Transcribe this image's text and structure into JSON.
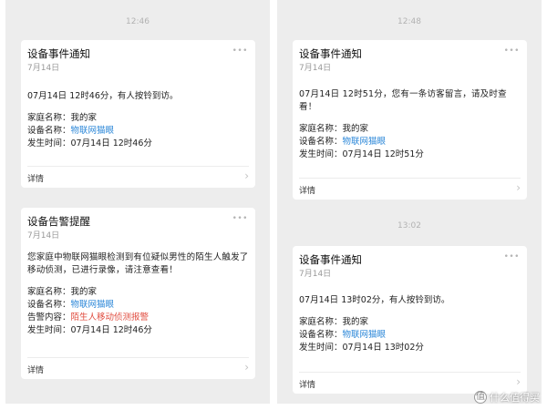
{
  "left_panel": {
    "timestamp": "12:46",
    "card1": {
      "title": "设备事件通知",
      "date": "7月14日",
      "message": "07月14日 12时46分，有人按铃到访。",
      "home_label": "家庭名称：",
      "home_value": "我的家",
      "device_label": "设备名称：",
      "device_value": "物联网猫眼",
      "time_label": "发生时间：",
      "time_value": "07月14日 12时46分",
      "detail": "详情"
    },
    "card2": {
      "title": "设备告警提醒",
      "date": "7月14日",
      "message": "您家庭中物联网猫眼检测到有位疑似男性的陌生人触发了移动侦测，已进行录像，请注意查看！",
      "home_label": "家庭名称：",
      "home_value": "我的家",
      "device_label": "设备名称：",
      "device_value": "物联网猫眼",
      "alert_label": "告警内容：",
      "alert_value": "陌生人移动侦测报警",
      "time_label": "发生时间：",
      "time_value": "07月14日 12时46分",
      "detail": "详情"
    }
  },
  "right_panel": {
    "timestamp1": "12:48",
    "card1": {
      "title": "设备事件通知",
      "date": "7月14日",
      "message": "07月14日 12时51分，您有一条访客留言，请及时查看！",
      "home_label": "家庭名称：",
      "home_value": "我的家",
      "device_label": "设备名称：",
      "device_value": "物联网猫眼",
      "time_label": "发生时间：",
      "time_value": "07月14日 12时51分",
      "detail": "详情"
    },
    "timestamp2": "13:02",
    "card2": {
      "title": "设备事件通知",
      "date": "7月14日",
      "message": "07月14日 13时02分，有人按铃到访。",
      "home_label": "家庭名称：",
      "home_value": "我的家",
      "device_label": "设备名称：",
      "device_value": "物联网猫眼",
      "time_label": "发生时间：",
      "time_value": "07月14日 13时02分",
      "detail": "详情"
    }
  },
  "icons": {
    "more": "more-dots-icon",
    "chevron": "chevron-right-icon",
    "watermark_logo": "smzdm-logo-icon"
  },
  "colors": {
    "link": "#2b87d8",
    "alert": "#e04b3e",
    "panel_bg": "#ededed"
  },
  "watermark": {
    "logo_char": "值",
    "text": "什么值得买"
  }
}
